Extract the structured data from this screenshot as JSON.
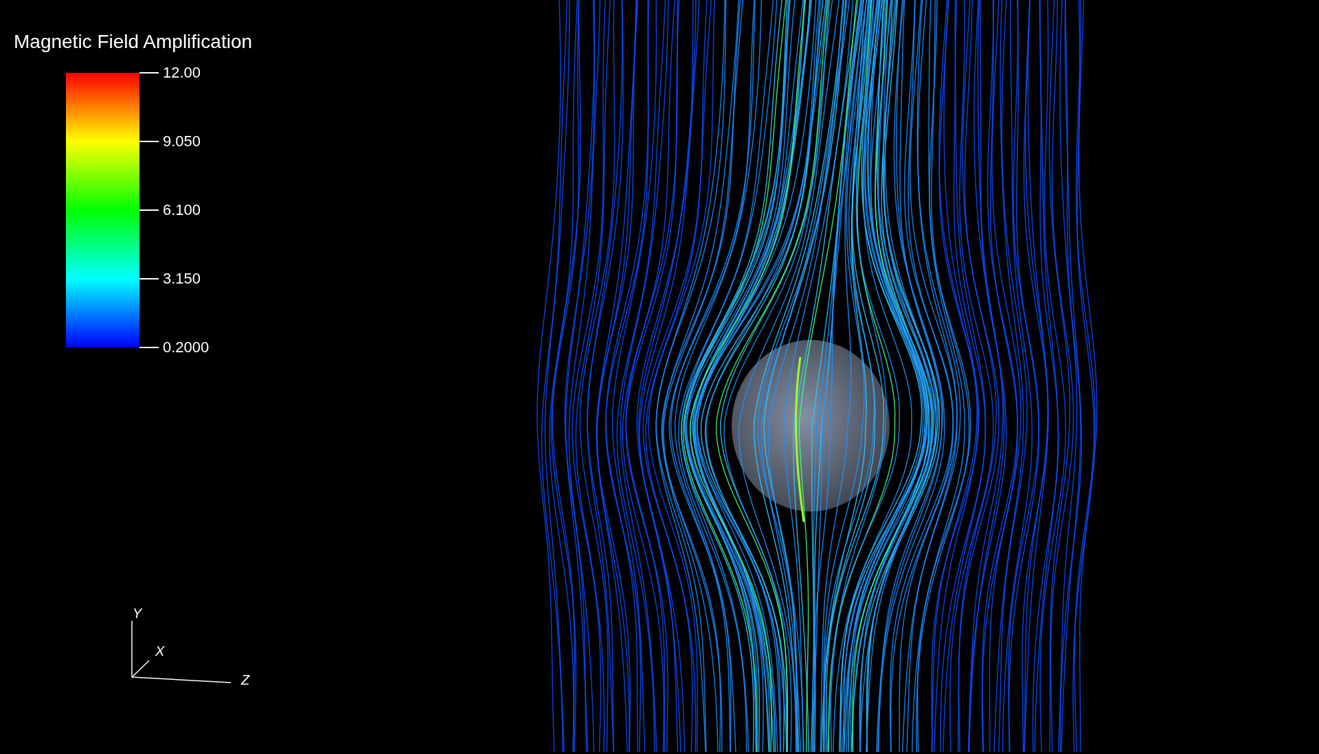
{
  "legend": {
    "title": "Magnetic Field Amplification",
    "ticks": [
      "12.00",
      "9.050",
      "6.100",
      "3.150",
      "0.2000"
    ]
  },
  "orientation_axes": {
    "y": "Y",
    "x": "X",
    "z": "Z"
  }
}
